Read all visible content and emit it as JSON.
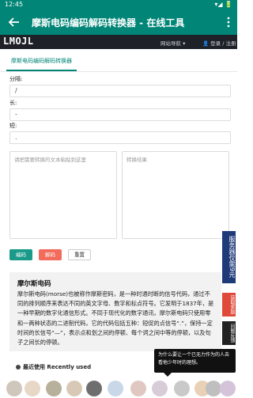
{
  "status_bar": {
    "time": "12:45",
    "icons": "▾◢ 🔋"
  },
  "app_bar": {
    "title": "摩斯电码编码解码转换器 - 在线工具"
  },
  "site": {
    "logo": "LMOJL",
    "nav_label": "网站导航 ▾",
    "login_label": "👤 登录 / 注册"
  },
  "tab": {
    "label": "摩斯电码编码解码转换器"
  },
  "form": {
    "separator_label": "分隔:",
    "separator_value": "/",
    "long_label": "长:",
    "long_value": "-",
    "short_label": "短:",
    "short_value": ".",
    "input_placeholder": "请把需要转换的文本粘贴到这里",
    "output_placeholder": "转换结果"
  },
  "buttons": {
    "encode": "编码",
    "decode": "解码",
    "clear": "重置"
  },
  "info": {
    "heading": "摩尔斯电码",
    "body": "摩尔斯电码(morse)也被称作摩斯密码，是一种时通时断的信号代码，通过不同的排列顺序来表达不同的英文字母、数字和标点符号。它发明于1837年，是一种早期的数字化通信形式。不同于现代化的数字通讯，摩尔斯电码只使用零和一两种状态的二进制代码，它的代码包括五种：短促的点信号“.”，保持一定时间的长信号“—”，表示点和划之间的停顿、每个词之间中等的停顿，以及句子之间长的停顿。"
  },
  "recent": {
    "title": "最近使用 Recently used",
    "avatar_count": 12
  },
  "side": {
    "service": "服务器仅需9元",
    "reward": "获取奖励",
    "feedback": "问题反馈"
  },
  "toast": {
    "text": "为什么要让一个已无力作为的人去看他少年时的理想。"
  },
  "colors": {
    "primary": "#008577",
    "encode": "#1a9a8a",
    "decode": "#f26b5b",
    "dark": "#1e2127"
  }
}
